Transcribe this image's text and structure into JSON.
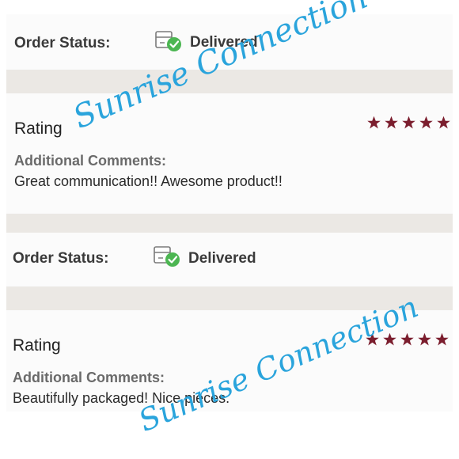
{
  "orders": [
    {
      "status_label": "Order Status:",
      "status_value": "Delivered",
      "rating_title": "Rating",
      "stars": 5,
      "comments_label": "Additional Comments:",
      "comments_text": "Great communication!! Awesome product!!"
    },
    {
      "status_label": "Order Status:",
      "status_value": "Delivered",
      "rating_title": "Rating",
      "stars": 5,
      "comments_label": "Additional Comments:",
      "comments_text": "Beautifully packaged! Nice pieces."
    }
  ],
  "watermarks": [
    "Sunrise Connection",
    "Sunrise Connection"
  ],
  "icons": {
    "status": "package-delivered-icon",
    "star": "star-icon"
  },
  "colors": {
    "star": "#7b1e2e",
    "check": "#4cb652",
    "watermark": "#2aa4dc",
    "band": "#ebe8e4",
    "card": "#fbfbfb"
  }
}
